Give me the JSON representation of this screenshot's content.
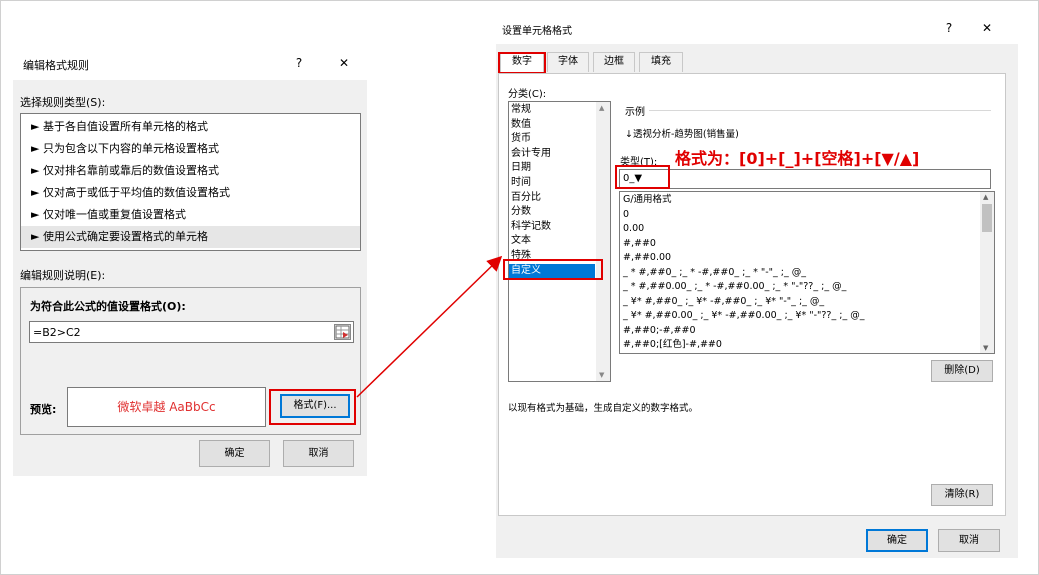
{
  "edit_rule": {
    "title": "编辑格式规则",
    "help": "?",
    "close": "✕",
    "select_type_label": "选择规则类型(S):",
    "rule_types": [
      "基于各自值设置所有单元格的格式",
      "只为包含以下内容的单元格设置格式",
      "仅对排名靠前或靠后的数值设置格式",
      "仅对高于或低于平均值的数值设置格式",
      "仅对唯一值或重复值设置格式",
      "使用公式确定要设置格式的单元格"
    ],
    "bullet": "►",
    "desc_label": "编辑规则说明(E):",
    "formula_label": "为符合此公式的值设置格式(O):",
    "formula_value": "=B2>C2",
    "preview_label": "预览:",
    "preview_text": "微软卓越  AaBbCc",
    "format_button": "格式(F)...",
    "ok": "确定",
    "cancel": "取消"
  },
  "format_cells": {
    "title": "设置单元格格式",
    "help": "?",
    "close": "✕",
    "tabs": [
      "数字",
      "字体",
      "边框",
      "填充"
    ],
    "category_label": "分类(C):",
    "categories": [
      "常规",
      "数值",
      "货币",
      "会计专用",
      "日期",
      "时间",
      "百分比",
      "分数",
      "科学记数",
      "文本",
      "特殊",
      "自定义"
    ],
    "sample_label": "示例",
    "sample_value": "↓透视分析-趋势图(销售量)",
    "type_label": "类型(T):",
    "type_value": "0_▼",
    "annotation": "格式为：[0]+[_]+[空格]+[▼/▲]",
    "format_list": [
      "G/通用格式",
      "0",
      "0.00",
      "#,##0",
      "#,##0.00",
      "_ * #,##0_ ;_ * -#,##0_ ;_ * \"-\"_ ;_ @_",
      "_ * #,##0.00_ ;_ * -#,##0.00_ ;_ * \"-\"??_ ;_ @_",
      "_ ¥* #,##0_ ;_ ¥* -#,##0_ ;_ ¥* \"-\"_ ;_ @_",
      "_ ¥* #,##0.00_ ;_ ¥* -#,##0.00_ ;_ ¥* \"-\"??_ ;_ @_",
      "#,##0;-#,##0",
      "#,##0;[红色]-#,##0"
    ],
    "delete_button": "删除(D)",
    "hint": "以现有格式为基础，生成自定义的数字格式。",
    "clear_button": "清除(R)",
    "ok": "确定",
    "cancel": "取消"
  }
}
